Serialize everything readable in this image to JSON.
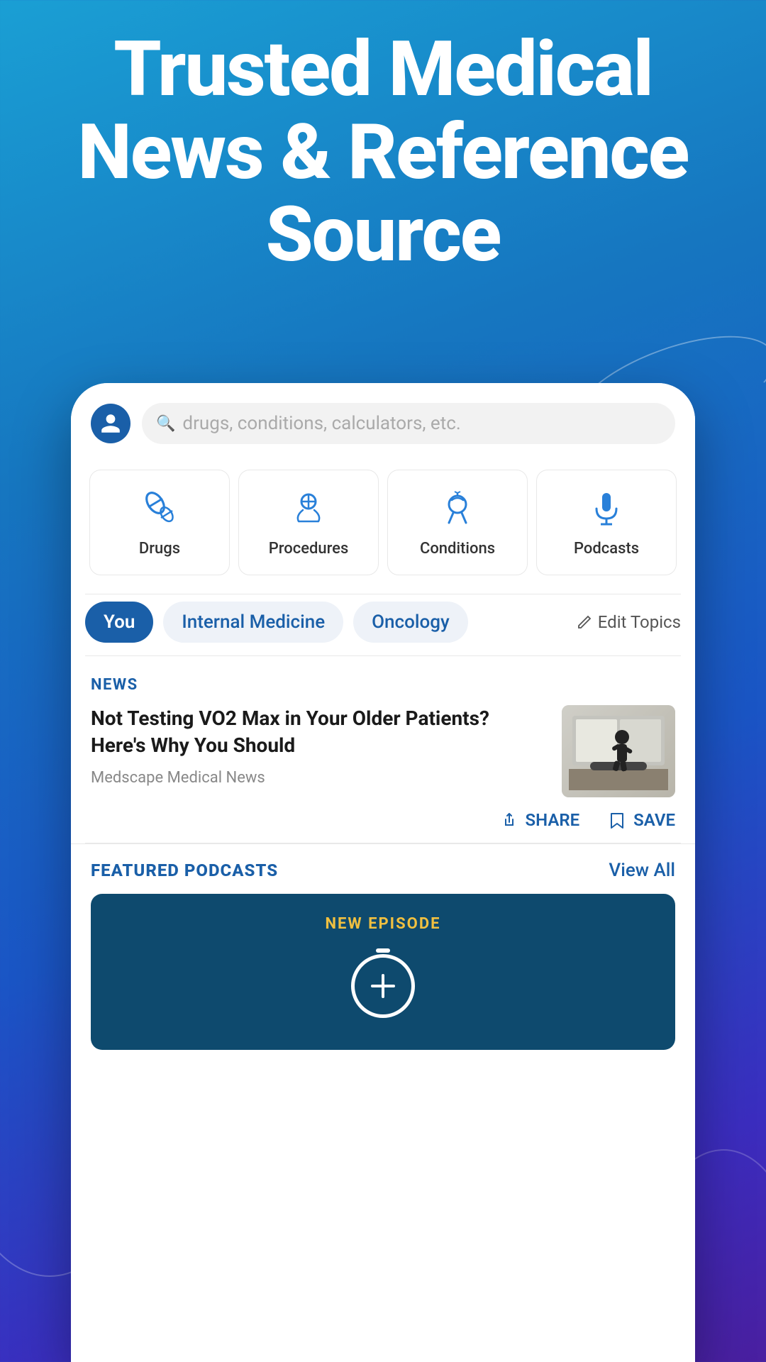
{
  "hero": {
    "title": "Trusted Medical News & Reference Source"
  },
  "search": {
    "placeholder": "drugs, conditions, calculators, etc."
  },
  "categories": [
    {
      "id": "drugs",
      "label": "Drugs",
      "icon": "pill"
    },
    {
      "id": "procedures",
      "label": "Procedures",
      "icon": "scalpel"
    },
    {
      "id": "conditions",
      "label": "Conditions",
      "icon": "stethoscope"
    },
    {
      "id": "podcasts",
      "label": "Podcasts",
      "icon": "microphone"
    }
  ],
  "topics": {
    "you_label": "You",
    "tabs": [
      "Internal Medicine",
      "Oncology"
    ],
    "edit_label": "Edit Topics"
  },
  "news": {
    "section_label": "NEWS",
    "title": "Not Testing VO2 Max in Your Older Patients? Here's Why You Should",
    "source": "Medscape Medical News",
    "share_label": "SHARE",
    "save_label": "SAVE"
  },
  "featured_podcasts": {
    "section_label": "FEATURED PODCASTS",
    "view_all_label": "View All",
    "badge": "NEW EPISODE"
  }
}
